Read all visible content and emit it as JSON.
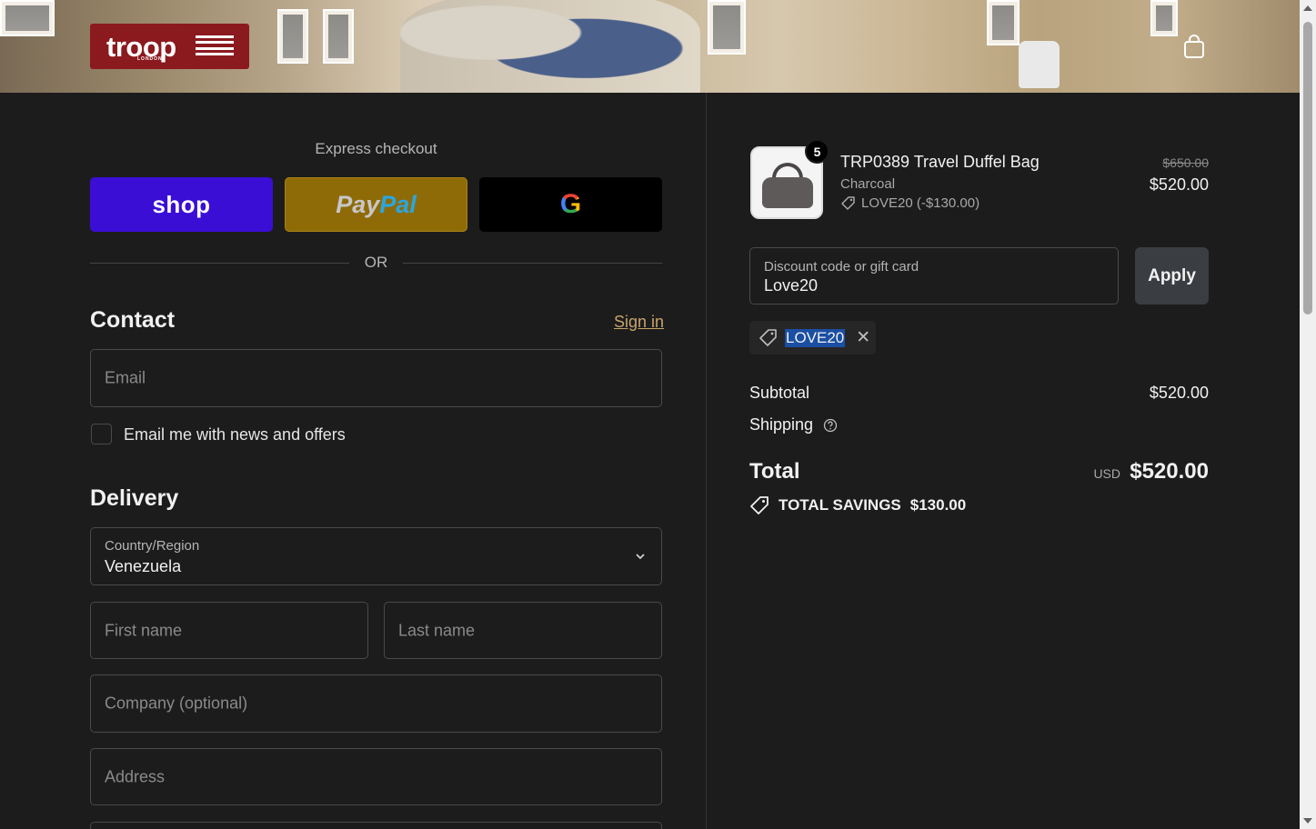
{
  "brand": {
    "name": "troop",
    "sub": "LONDON"
  },
  "express": {
    "title": "Express checkout",
    "shop_label": "shop",
    "paypal_label_1": "Pay",
    "paypal_label_2": "Pal",
    "gpay_label": "G"
  },
  "divider": {
    "or": "OR"
  },
  "contact": {
    "title": "Contact",
    "sign_in": "Sign in",
    "email_placeholder": "Email",
    "news_label": "Email me with news and offers"
  },
  "delivery": {
    "title": "Delivery",
    "country_label": "Country/Region",
    "country_value": "Venezuela",
    "first_name_placeholder": "First name",
    "last_name_placeholder": "Last name",
    "company_placeholder": "Company (optional)",
    "address_placeholder": "Address"
  },
  "cart": {
    "quantity": "5",
    "product_name": "TRP0389 Travel Duffel Bag",
    "variant": "Charcoal",
    "discount_line": "LOVE20 (-$130.00)",
    "price_original": "$650.00",
    "price_final": "$520.00"
  },
  "discount": {
    "label": "Discount code or gift card",
    "value": "Love20",
    "apply": "Apply",
    "applied_code": "LOVE20"
  },
  "summary": {
    "subtotal_label": "Subtotal",
    "subtotal_value": "$520.00",
    "shipping_label": "Shipping",
    "total_label": "Total",
    "currency": "USD",
    "total_value": "$520.00",
    "savings_label": "TOTAL SAVINGS",
    "savings_value": "$130.00"
  },
  "colors": {
    "background": "#1c1c1c",
    "shop": "#3b0ed6",
    "paypal": "#8f6b08",
    "brand_red": "#8b1a1f",
    "link": "#c7a46b"
  }
}
